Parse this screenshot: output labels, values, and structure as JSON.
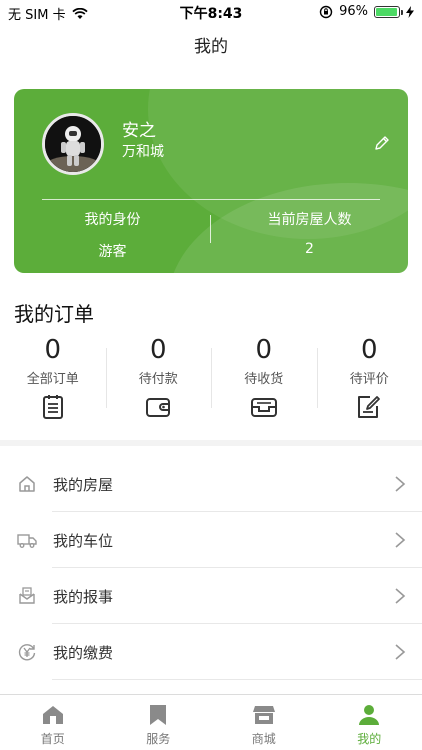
{
  "status_bar": {
    "carrier": "无 SIM 卡",
    "time": "下午8:43",
    "battery": "96%"
  },
  "nav": {
    "title": "我的"
  },
  "profile": {
    "name": "安之",
    "community": "万和城",
    "identity_label": "我的身份",
    "identity_value": "游客",
    "occupants_label": "当前房屋人数",
    "occupants_value": "2"
  },
  "orders": {
    "title": "我的订单",
    "items": [
      {
        "count": "0",
        "label": "全部订单",
        "icon": "clipboard-icon"
      },
      {
        "count": "0",
        "label": "待付款",
        "icon": "wallet-icon"
      },
      {
        "count": "0",
        "label": "待收货",
        "icon": "inbox-icon"
      },
      {
        "count": "0",
        "label": "待评价",
        "icon": "review-icon"
      }
    ]
  },
  "menu": [
    {
      "label": "我的房屋",
      "icon": "house-icon"
    },
    {
      "label": "我的车位",
      "icon": "truck-icon"
    },
    {
      "label": "我的报事",
      "icon": "mail-icon"
    },
    {
      "label": "我的缴费",
      "icon": "yuan-icon"
    }
  ],
  "tabs": [
    {
      "label": "首页",
      "icon": "home-icon"
    },
    {
      "label": "服务",
      "icon": "bookmark-icon"
    },
    {
      "label": "商城",
      "icon": "store-icon"
    },
    {
      "label": "我的",
      "icon": "user-icon",
      "active": true
    }
  ],
  "colors": {
    "accent": "#5cad3a",
    "battery": "#4cd964"
  }
}
